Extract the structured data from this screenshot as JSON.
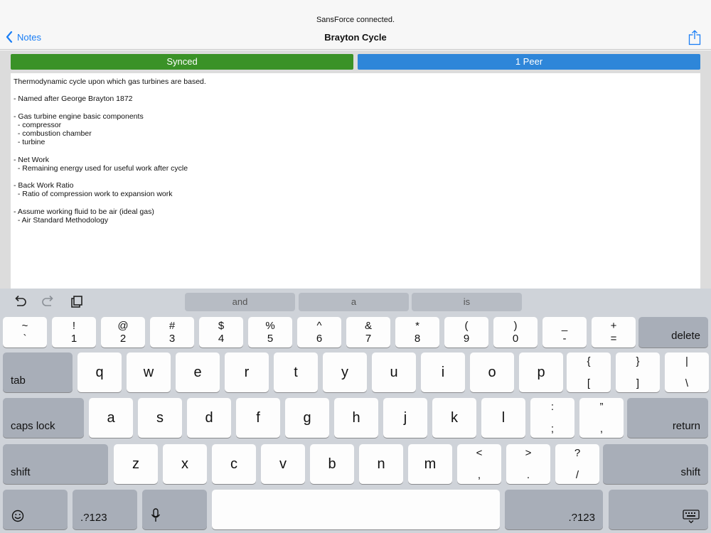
{
  "status": {
    "text": "SansForce connected."
  },
  "nav": {
    "back_label": "Notes",
    "title": "Brayton Cycle"
  },
  "sync": {
    "synced_label": "Synced",
    "peer_label": "1 Peer"
  },
  "colors": {
    "accent": "#1a7ef5",
    "synced": "#3a9227",
    "peer": "#2e86d9"
  },
  "note_lines": [
    "Thermodynamic cycle upon which gas turbines are based.",
    "",
    "- Named after George Brayton 1872",
    "",
    "- Gas turbine engine basic components",
    "  - compressor",
    "  - combustion chamber",
    "  - turbine",
    "",
    "- Net Work",
    "  - Remaining energy used for useful work after cycle",
    "",
    "- Back Work Ratio",
    "  - Ratio of compression work to expansion work",
    "",
    "- Assume working fluid to be air (ideal gas)",
    "  - Air Standard Methodology"
  ],
  "keyboard": {
    "shortcuts": [
      "undo-icon",
      "redo-icon",
      "paste-icon"
    ],
    "suggestions": [
      "and",
      "a",
      "is"
    ],
    "row1": [
      {
        "top": "~",
        "bottom": "`"
      },
      {
        "top": "!",
        "bottom": "1"
      },
      {
        "top": "@",
        "bottom": "2"
      },
      {
        "top": "#",
        "bottom": "3"
      },
      {
        "top": "$",
        "bottom": "4"
      },
      {
        "top": "%",
        "bottom": "5"
      },
      {
        "top": "^",
        "bottom": "6"
      },
      {
        "top": "&",
        "bottom": "7"
      },
      {
        "top": "*",
        "bottom": "8"
      },
      {
        "top": "(",
        "bottom": "9"
      },
      {
        "top": ")",
        "bottom": "0"
      },
      {
        "top": "_",
        "bottom": "-"
      },
      {
        "top": "+",
        "bottom": "="
      }
    ],
    "delete_label": "delete",
    "tab_label": "tab",
    "row2": [
      "q",
      "w",
      "e",
      "r",
      "t",
      "y",
      "u",
      "i",
      "o",
      "p"
    ],
    "row2_sym": [
      {
        "top": "{",
        "bottom": "["
      },
      {
        "top": "}",
        "bottom": "]"
      },
      {
        "top": "|",
        "bottom": "\\"
      }
    ],
    "caps_label": "caps lock",
    "row3": [
      "a",
      "s",
      "d",
      "f",
      "g",
      "h",
      "j",
      "k",
      "l"
    ],
    "row3_sym": [
      {
        "top": ":",
        "bottom": ";"
      },
      {
        "top": "”",
        "bottom": ","
      }
    ],
    "return_label": "return",
    "shift_label": "shift",
    "row4": [
      "z",
      "x",
      "c",
      "v",
      "b",
      "n",
      "m"
    ],
    "row4_sym": [
      {
        "top": "<",
        "bottom": ","
      },
      {
        "top": ">",
        "bottom": "."
      },
      {
        "top": "?",
        "bottom": "/"
      }
    ],
    "numbers_label": ".?123",
    "icons": [
      "emoji-icon",
      "microphone-icon",
      "keyboard-dismiss-icon"
    ]
  }
}
